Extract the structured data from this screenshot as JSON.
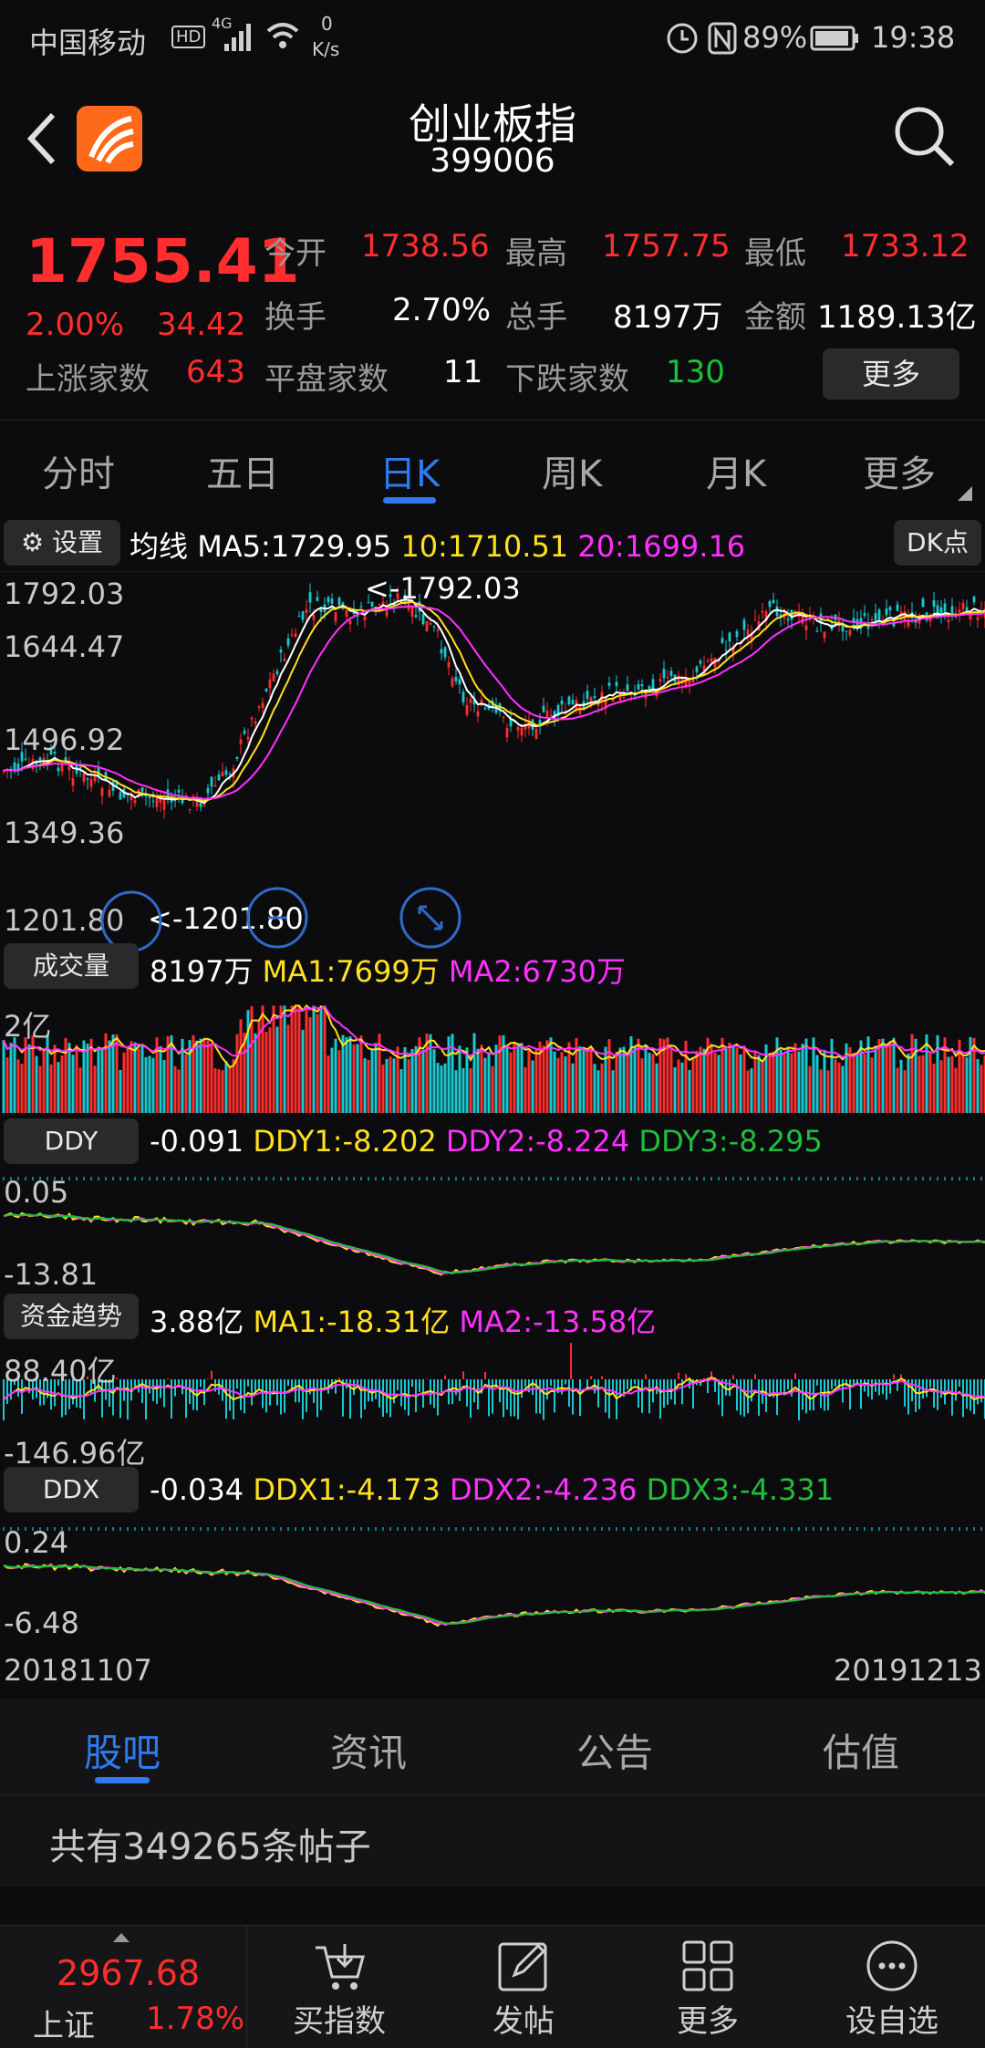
{
  "status_bar": {
    "carrier": "中国移动",
    "hd": "HD",
    "network": "4G",
    "speed_value": "0",
    "speed_unit": "K/s",
    "battery": "89%",
    "time": "19:38"
  },
  "header": {
    "title": "创业板指",
    "code": "399006"
  },
  "quote": {
    "price": "1755.41",
    "change_pct": "2.00%",
    "change": "34.42",
    "open_label": "今开",
    "open": "1738.56",
    "high_label": "最高",
    "high": "1757.75",
    "low_label": "最低",
    "low": "1733.12",
    "turnover_label": "换手",
    "turnover": "2.70%",
    "volume_label": "总手",
    "volume": "8197万",
    "amount_label": "金额",
    "amount": "1189.13亿",
    "up_label": "上涨家数",
    "up": "643",
    "flat_label": "平盘家数",
    "flat": "11",
    "down_label": "下跌家数",
    "down": "130",
    "more_button": "更多"
  },
  "tabs": [
    {
      "label": "分时",
      "active": false
    },
    {
      "label": "五日",
      "active": false
    },
    {
      "label": "日K",
      "active": true
    },
    {
      "label": "周K",
      "active": false
    },
    {
      "label": "月K",
      "active": false
    },
    {
      "label": "更多",
      "active": false
    }
  ],
  "kline": {
    "settings_button": "设置",
    "ma_title": "均线",
    "ma5": "MA5:1729.95",
    "ma10": "10:1710.51",
    "ma20": "20:1699.16",
    "dk_button": "DK点",
    "axis": [
      "1792.03",
      "1644.47",
      "1496.92",
      "1349.36",
      "1201.80"
    ],
    "max_marker": "<-1792.03",
    "min_marker": "<-1201.80"
  },
  "volume": {
    "button": "成交量",
    "value": "8197万",
    "ma1": "MA1:7699万",
    "ma2": "MA2:6730万",
    "axis_top": "2亿"
  },
  "ddy": {
    "button": "DDY",
    "value": "-0.091",
    "v1": "DDY1:-8.202",
    "v2": "DDY2:-8.224",
    "v3": "DDY3:-8.295",
    "axis_top": "0.05",
    "axis_bottom": "-13.81"
  },
  "fund": {
    "button": "资金趋势",
    "value": "3.88亿",
    "ma1": "MA1:-18.31亿",
    "ma2": "MA2:-13.58亿",
    "axis_top": "88.40亿",
    "axis_bottom": "-146.96亿"
  },
  "ddx": {
    "button": "DDX",
    "value": "-0.034",
    "v1": "DDX1:-4.173",
    "v2": "DDX2:-4.236",
    "v3": "DDX3:-4.331",
    "axis_top": "0.24",
    "axis_bottom": "-6.48"
  },
  "date_range": {
    "start": "20181107",
    "end": "20191213"
  },
  "bottom_tabs": [
    {
      "label": "股吧",
      "active": true
    },
    {
      "label": "资讯",
      "active": false
    },
    {
      "label": "公告",
      "active": false
    },
    {
      "label": "估值",
      "active": false
    }
  ],
  "posts": {
    "text": "共有349265条帖子"
  },
  "bottom_bar": {
    "index_value": "2967.68",
    "index_name": "上证",
    "index_change": "1.78%",
    "items": [
      {
        "label": "买指数",
        "icon": "cart-icon"
      },
      {
        "label": "发帖",
        "icon": "edit-icon"
      },
      {
        "label": "更多",
        "icon": "grid-icon"
      },
      {
        "label": "设自选",
        "icon": "dots-circle-icon"
      }
    ]
  },
  "colors": {
    "up": "#ff2d2d",
    "down": "#18c9d0",
    "ma5": "#ffffff",
    "ma10": "#ffe020",
    "ma20": "#ff30ff",
    "accent": "#2e7bf0"
  }
}
